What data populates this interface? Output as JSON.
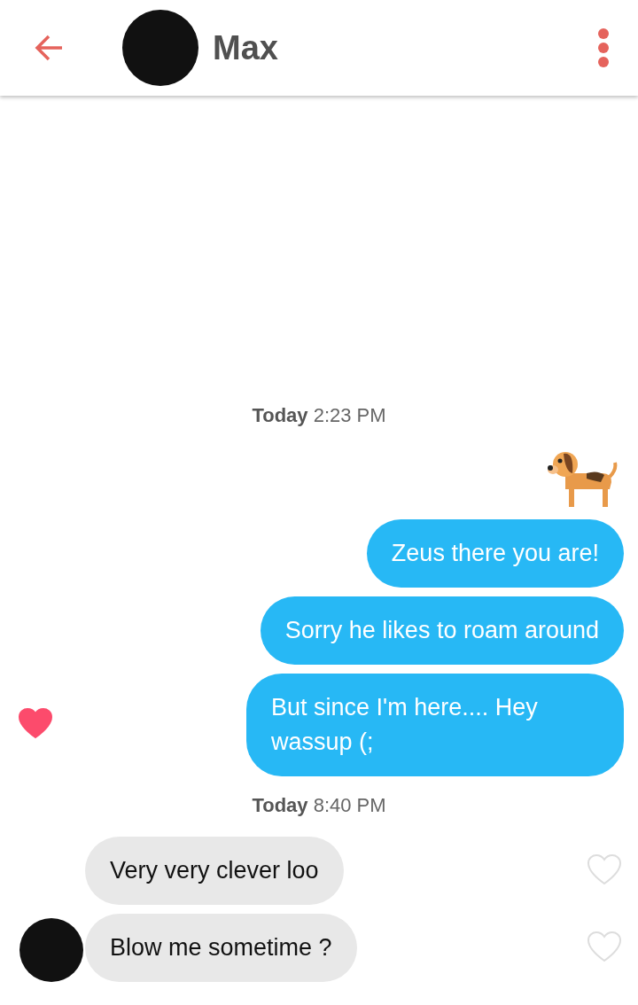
{
  "header": {
    "name": "Max"
  },
  "items": [
    {
      "kind": "timestamp",
      "text": "**Today** 2:23 PM"
    },
    {
      "kind": "sticker",
      "liked": false
    },
    {
      "kind": "text",
      "sent": true,
      "text": "Zeus there you are!",
      "liked": false
    },
    {
      "kind": "text",
      "sent": true,
      "text": "Sorry he likes to roam around",
      "liked": false
    },
    {
      "kind": "text",
      "sent": true,
      "text": "But since I'm here.... Hey wassup (;",
      "liked": true
    },
    {
      "kind": "timestamp",
      "text": "**Today** 8:40 PM"
    },
    {
      "kind": "text",
      "sent": false,
      "text": "Very very clever loo",
      "liked": false
    },
    {
      "kind": "text",
      "sent": false,
      "text": "Blow me sometime ?",
      "liked": false
    }
  ]
}
